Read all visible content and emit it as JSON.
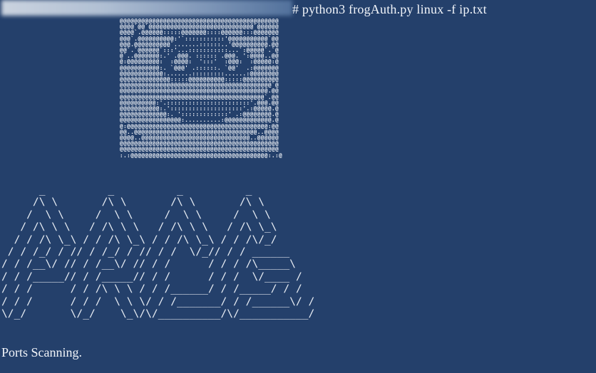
{
  "terminal": {
    "background": "#24406b",
    "foreground": "#e8edf4",
    "prompt_command": "# python3 frogAuth.py linux -f ip.txt",
    "status_text": "Ports Scanning.",
    "frog_ascii": "@@@@@@@@@@@@@@@@@@@@@@@@@@@@@@@@@@@@@@@@@@@@\n@@@@`@@`@@@@@@@@@@@@@@@@@@@@@@@@@@@@@`@@@@@@\n@@@@`.@@@@@@:::::@@@@@@@::::@@@@@@:::@@@@@@@\n@@@`.@@@@@@@@@@:'`:::::::::::'@@@@@@@@@@@`@@\n@@@.@@@@@@@@@@`.......::::::..'@@@@@@@@@@.@@\n@@`.`@@@@@@`:::'...:::::::::::...`:@@@@@`.`@\n@`..@@@@@@@:.' .@@@. :::::: .@@@. ':@@@@..@@\n@:@@@@@@@@@:  :@@@@:  ':::'  :@@@:  :@@@@@:@\n@@@@@@@@@@@:. `@@@' .::::::. `@@'  .:@@@@@@@\n@@@@@@@@@@@@:.......:::::::::......:@@@@@@@@\n@@@@@@@@@@@@@@:::::@@@@@@@@@@:::::@@@@@@@@@@\n@@@@@@@@@@@@@@@@@@@@@@@@@@@@@@@@@@@@@@@@@@`@\n@@@@@@@@@@@@@@@@@@@@@@@@@@@@@@@@@@@@@@@@@.@@\n@@@@@@@@@@@@@@@@@@@@@@@@@@@@@@@@@@@@@@@@`.@@\n@@@@@@@@@@:'.:::::::::::::::::::::::'.@@@.@@\n@@@@@@@@@@@:.'::::::::::::::::::::'.:@@@@@.@\n@@@@@@@@@@@@@:. ':::::::::::::' .:@@@@@@@@.@\n@@@@@@@@@@@@@@@@@:..........:@@@@@@@@@@@@@.@\n@:@@@@@@@@@@@@@@@@@@@@@@@@@@@@@@@@@@@@@@@:@@\n@@..@@@@@@@@@@@@@@@@@@@@@@@@@@@@@@@@@@..@@@@\n@@@@..@@@@@@@@@@@@@@@@@@@@@@@@@@@@@@..@@@@@@\n@@@@@@@@@@@@@@@@@@@@@@@@@@@@@@@@@@@@@@@@@@@@\n@@@@@@@@@@@@@@@@@@@@@@@@@@@@@@@@@@@@@@@@@@@@\n:.:@@@@@@@@@@@@@@@@@@@@@@@@@@@@@@@@@@@@@@:.:@",
    "banner_ascii": "      _          _          _          _\n     /\\ \\       /\\ \\       /\\ \\       /\\ \\\n    /  \\ \\     /  \\ \\     /  \\ \\     /  \\ \\\n   / /\\ \\ \\   / /\\ \\ \\   / /\\ \\ \\   / /\\ \\_\\\n  / / /\\ \\_\\ / / /\\ \\_\\ / / /\\ \\_\\ / / /\\/_/\n / / /_/ / // / /_/ / // / /  \\/_// / / ______\n/ / /__\\/ // / /__\\/ // / /      / / / /\\_____\\\n/ / /_____// / /_____// / /      / / /  \\/____ /\n/ / /      / / /\\ \\ \\ / / /______/ / /_____/ / /\n/ / /      / / /  \\ \\ \\/ / /_______/ / /______\\/ /\n\\/_/       \\/_/    \\_\\/\\/__________/\\/___________/"
  }
}
